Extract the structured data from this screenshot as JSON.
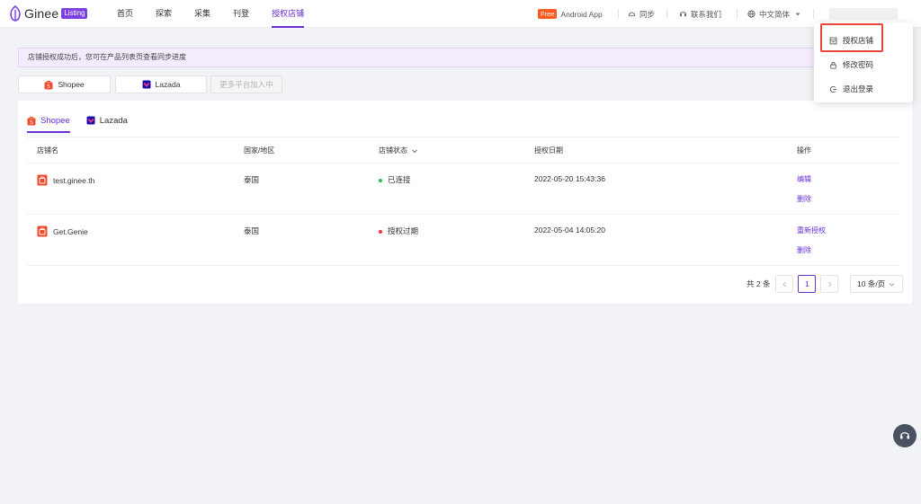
{
  "header": {
    "logo_text": "Ginee",
    "logo_badge": "Listing",
    "nav": [
      "首页",
      "探索",
      "采集",
      "刊登",
      "授权店铺"
    ],
    "free_badge": "Free",
    "android_app": "Android App",
    "sync": "同步",
    "contact": "联系我们",
    "language": "中文简体"
  },
  "notice": "店铺授权成功后，您可在产品列表页查看同步进度",
  "platform_buttons": {
    "shopee": "Shopee",
    "lazada": "Lazada",
    "more": "更多平台加入中"
  },
  "tabs": [
    "Shopee",
    "Lazada"
  ],
  "table": {
    "headers": [
      "店铺名",
      "国家/地区",
      "店铺状态",
      "授权日期",
      "操作"
    ],
    "rows": [
      {
        "shop": "test.ginee.th",
        "country": "泰国",
        "status": "已连接",
        "status_color": "#2dbd49",
        "date": "2022-05-20 15:43:36",
        "actions": [
          "编辑",
          "删除"
        ]
      },
      {
        "shop": "Get.Genie",
        "country": "泰国",
        "status": "授权过期",
        "status_color": "#f0323c",
        "date": "2022-05-04 14:05:20",
        "actions": [
          "重新授权",
          "删除"
        ]
      }
    ]
  },
  "pagination": {
    "total": "共 2 条",
    "current_page": "1",
    "page_size": "10 条/页"
  },
  "dropdown": [
    "授权店铺",
    "修改密码",
    "退出登录"
  ],
  "colors": {
    "primary": "#6a2fd6",
    "shopee": "#ee4d2d",
    "lazada": "#1a0bad",
    "highlight": "#e8473b"
  }
}
